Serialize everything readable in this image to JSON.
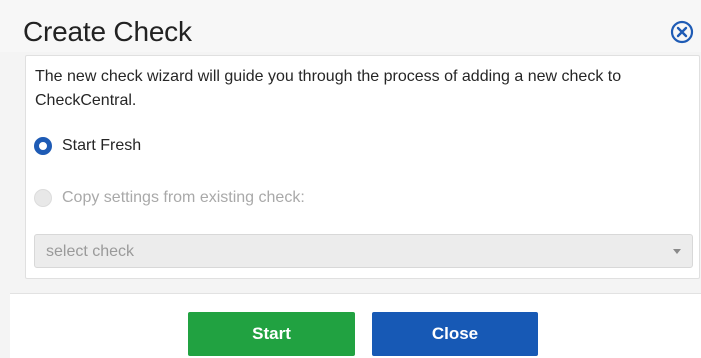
{
  "dialog": {
    "title": "Create Check",
    "close_icon": "close-circle-x-icon",
    "description": "The new check wizard will guide you through the process of adding a new check to CheckCentral.",
    "options": {
      "start_fresh": {
        "label": "Start Fresh",
        "selected": true
      },
      "copy_existing": {
        "label": "Copy settings from existing check:",
        "selected": false,
        "disabled": true
      }
    },
    "select": {
      "value": "select check",
      "disabled": true
    },
    "buttons": {
      "start_label": "Start",
      "close_label": "Close"
    }
  },
  "colors": {
    "accent_blue": "#1759b5",
    "start_green": "#21a241",
    "radio_blue": "#1e5bb5"
  }
}
